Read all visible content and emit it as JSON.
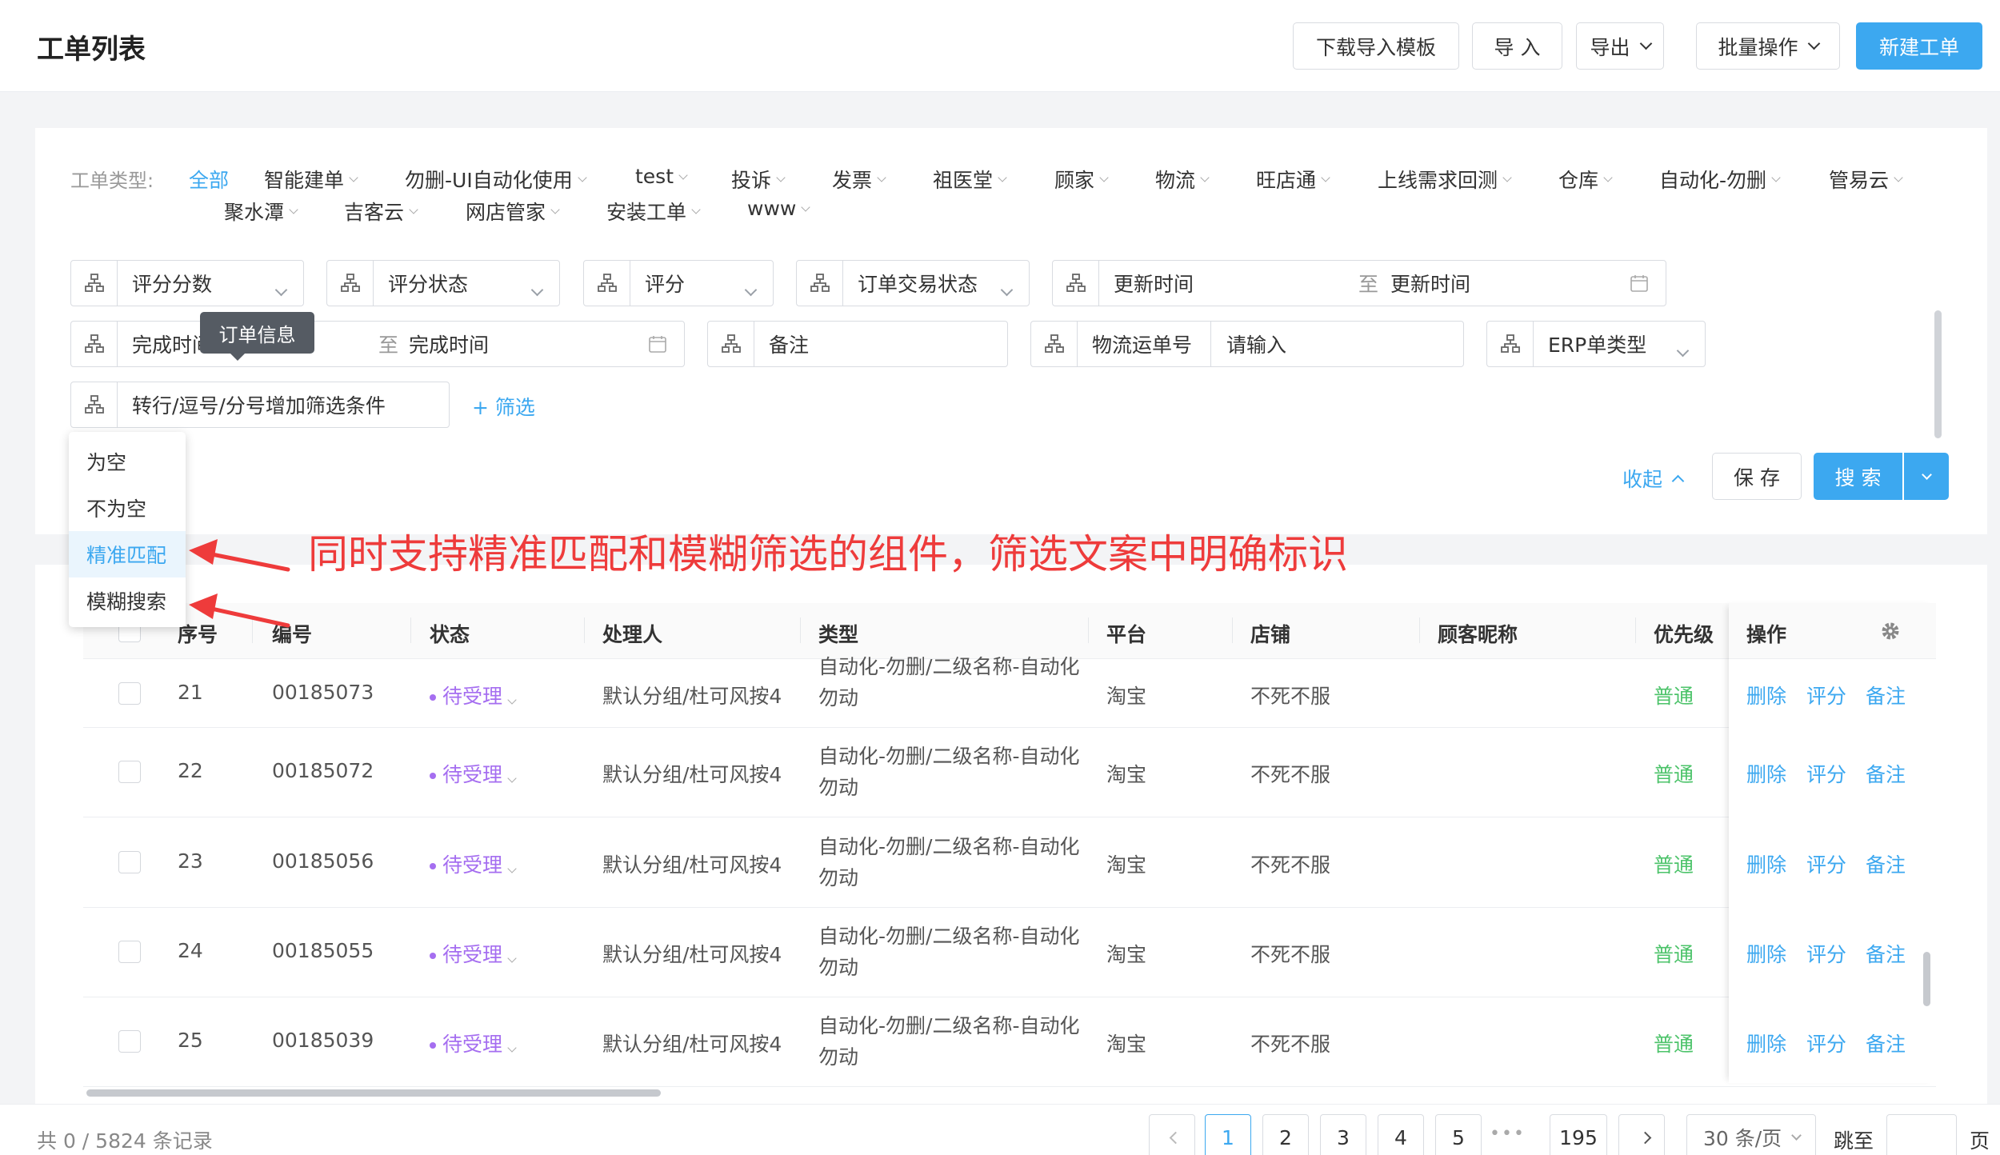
{
  "header": {
    "title": "工单列表",
    "buttons": {
      "download_template": "下载导入模板",
      "import": "导 入",
      "export": "导出",
      "batch": "批量操作",
      "new_ticket": "新建工单"
    }
  },
  "types": {
    "label": "工单类型:",
    "items": [
      "全部",
      "智能建单",
      "勿删-UI自动化使用",
      "test",
      "投诉",
      "发票",
      "祖医堂",
      "顾家",
      "物流",
      "旺店通",
      "上线需求回测",
      "仓库",
      "自动化-勿删",
      "管易云",
      "聚水潭",
      "吉客云",
      "网店管家",
      "安装工单",
      "www"
    ]
  },
  "filters": {
    "score_value": "评分分数",
    "score_status": "评分状态",
    "score": "评分",
    "order_status": "订单交易状态",
    "update_time_start": "更新时间",
    "range_sep": "至",
    "update_time_end": "更新时间",
    "finish_time_start": "完成时间",
    "finish_time_end": "完成时间",
    "remark": "备注",
    "logistics_label": "物流运单号",
    "logistics_placeholder": "请输入",
    "erp_type": "ERP单类型",
    "multi_input": "转行/逗号/分号增加筛选条件",
    "add_filter": "+ 筛选",
    "collapse": "收起",
    "save": "保 存",
    "search": "搜 索"
  },
  "tooltip": "订单信息",
  "match_menu": [
    "为空",
    "不为空",
    "精准匹配",
    "模糊搜索"
  ],
  "annotation": "同时支持精准匹配和模糊筛选的组件，筛选文案中明确标识",
  "table": {
    "columns": [
      "序号",
      "编号",
      "状态",
      "处理人",
      "类型",
      "平台",
      "店铺",
      "顾客昵称",
      "优先级",
      "操作"
    ],
    "rows": [
      {
        "seq": "21",
        "id": "00185073",
        "status": "待受理",
        "handler": "默认分组/杜可风按4",
        "type": "自动化-勿删/二级名称-自动化勿动",
        "platform": "淘宝",
        "shop": "不死不服",
        "nick": "",
        "priority": "普通"
      },
      {
        "seq": "22",
        "id": "00185072",
        "status": "待受理",
        "handler": "默认分组/杜可风按4",
        "type": "自动化-勿删/二级名称-自动化勿动",
        "platform": "淘宝",
        "shop": "不死不服",
        "nick": "",
        "priority": "普通"
      },
      {
        "seq": "23",
        "id": "00185056",
        "status": "待受理",
        "handler": "默认分组/杜可风按4",
        "type": "自动化-勿删/二级名称-自动化勿动",
        "platform": "淘宝",
        "shop": "不死不服",
        "nick": "",
        "priority": "普通"
      },
      {
        "seq": "24",
        "id": "00185055",
        "status": "待受理",
        "handler": "默认分组/杜可风按4",
        "type": "自动化-勿删/二级名称-自动化勿动",
        "platform": "淘宝",
        "shop": "不死不服",
        "nick": "",
        "priority": "普通"
      },
      {
        "seq": "25",
        "id": "00185039",
        "status": "待受理",
        "handler": "默认分组/杜可风按4",
        "type": "自动化-勿删/二级名称-自动化勿动",
        "platform": "淘宝",
        "shop": "不死不服",
        "nick": "",
        "priority": "普通"
      }
    ],
    "actions": [
      "删除",
      "评分",
      "备注"
    ]
  },
  "footer": {
    "record_count": "共 0 / 5824 条记录",
    "pages": [
      "1",
      "2",
      "3",
      "4",
      "5"
    ],
    "ellipsis": "•••",
    "last_page": "195",
    "page_size": "30 条/页",
    "jump_label": "跳至",
    "page_suffix": "页"
  },
  "colors": {
    "accent": "#3ca8f0",
    "status_pending": "#a56ef0",
    "priority_normal": "#4cc36a",
    "annotation": "#ee3b3b"
  }
}
